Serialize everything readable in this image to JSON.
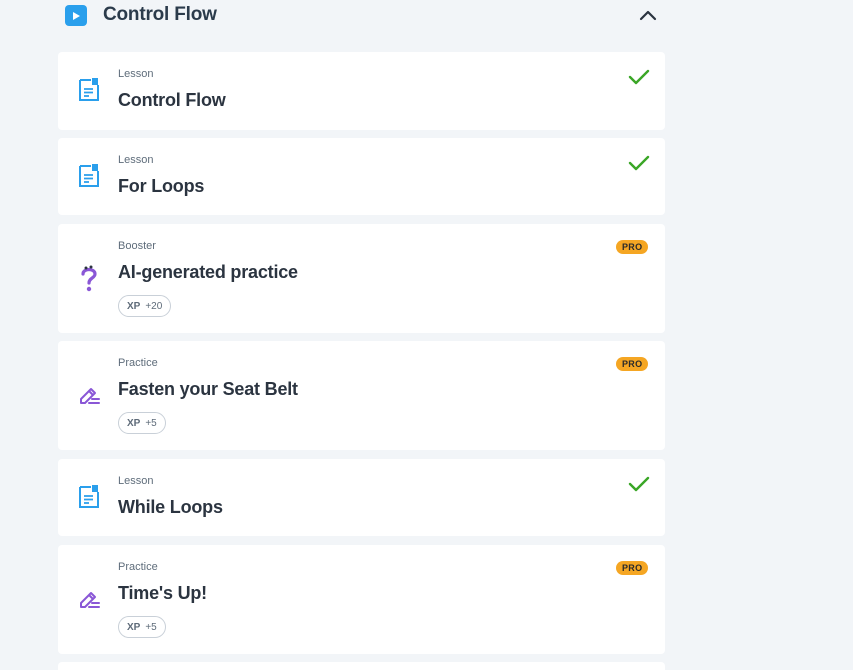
{
  "section": {
    "title": "Control Flow",
    "icon": "play-icon",
    "collapse_icon": "chevron-up-icon"
  },
  "items": [
    {
      "type": "Lesson",
      "title": "Control Flow",
      "icon": "lesson-document-icon",
      "status": "completed"
    },
    {
      "type": "Lesson",
      "title": "For Loops",
      "icon": "lesson-document-icon",
      "status": "completed"
    },
    {
      "type": "Booster",
      "title": "AI-generated practice",
      "icon": "question-mark-icon",
      "badge": "PRO",
      "xp_label": "XP",
      "xp_value": "+20"
    },
    {
      "type": "Practice",
      "title": "Fasten your Seat Belt",
      "icon": "pencil-icon",
      "badge": "PRO",
      "xp_label": "XP",
      "xp_value": "+5"
    },
    {
      "type": "Lesson",
      "title": "While Loops",
      "icon": "lesson-document-icon",
      "status": "completed"
    },
    {
      "type": "Practice",
      "title": "Time's Up!",
      "icon": "pencil-icon",
      "badge": "PRO",
      "xp_label": "XP",
      "xp_value": "+5"
    }
  ],
  "colors": {
    "background": "#f2f5f8",
    "accent_blue": "#2a9fec",
    "check_green": "#3aa626",
    "pro_orange": "#f5a623",
    "purple_icon": "#8a57d6"
  }
}
